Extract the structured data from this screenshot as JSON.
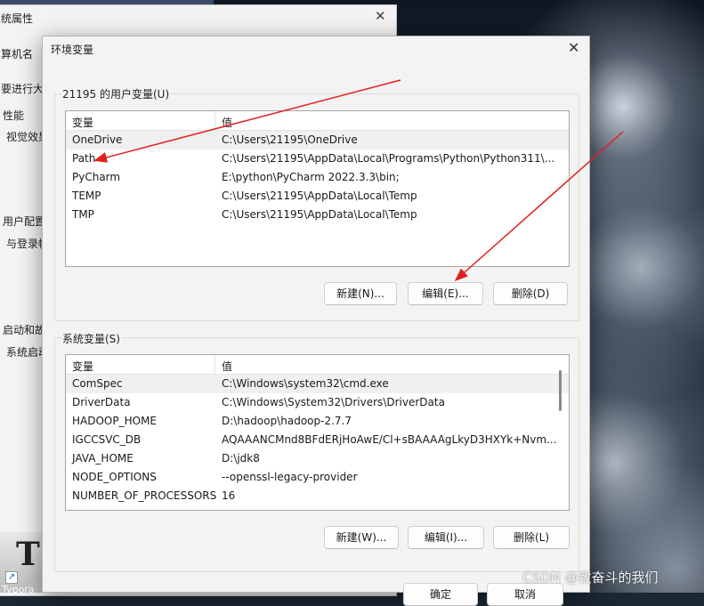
{
  "background_window": {
    "title": "统属性",
    "fragments": [
      "算机名",
      "要进行大",
      "性能",
      "视觉效果",
      "用户配置",
      "与登录帐",
      "启动和故",
      "系统启动"
    ]
  },
  "dialog": {
    "title": "环境变量",
    "user_group_label": "21195 的用户变量(U)",
    "system_group_label": "系统变量(S)",
    "col_variable": "变量",
    "col_value": "值",
    "user_vars": [
      {
        "name": "OneDrive",
        "value": "C:\\Users\\21195\\OneDrive"
      },
      {
        "name": "Path",
        "value": "C:\\Users\\21195\\AppData\\Local\\Programs\\Python\\Python311\\..."
      },
      {
        "name": "PyCharm",
        "value": "E:\\python\\PyCharm 2022.3.3\\bin;"
      },
      {
        "name": "TEMP",
        "value": "C:\\Users\\21195\\AppData\\Local\\Temp"
      },
      {
        "name": "TMP",
        "value": "C:\\Users\\21195\\AppData\\Local\\Temp"
      }
    ],
    "system_vars": [
      {
        "name": "ComSpec",
        "value": "C:\\Windows\\system32\\cmd.exe"
      },
      {
        "name": "DriverData",
        "value": "C:\\Windows\\System32\\Drivers\\DriverData"
      },
      {
        "name": "HADOOP_HOME",
        "value": "D:\\hadoop\\hadoop-2.7.7"
      },
      {
        "name": "IGCCSVC_DB",
        "value": "AQAAANCMnd8BFdERjHoAwE/Cl+sBAAAAgLkyD3HXYk+Nvm..."
      },
      {
        "name": "JAVA_HOME",
        "value": "D:\\jdk8"
      },
      {
        "name": "NODE_OPTIONS",
        "value": "--openssl-legacy-provider"
      },
      {
        "name": "NUMBER_OF_PROCESSORS",
        "value": "16"
      }
    ],
    "user_buttons": {
      "new": "新建(N)...",
      "edit": "编辑(E)...",
      "delete": "删除(D)"
    },
    "system_buttons": {
      "new": "新建(W)...",
      "edit": "编辑(I)...",
      "delete": "删除(L)"
    },
    "footer_buttons": {
      "ok": "确定",
      "cancel": "取消"
    }
  },
  "taskbar": {
    "app_label": "Typora",
    "app_glyph": "T"
  },
  "watermark": "CSDN @致奋斗的我们",
  "colors": {
    "annotation_arrow": "#e02020",
    "dialog_bg": "#f3f3f3"
  }
}
